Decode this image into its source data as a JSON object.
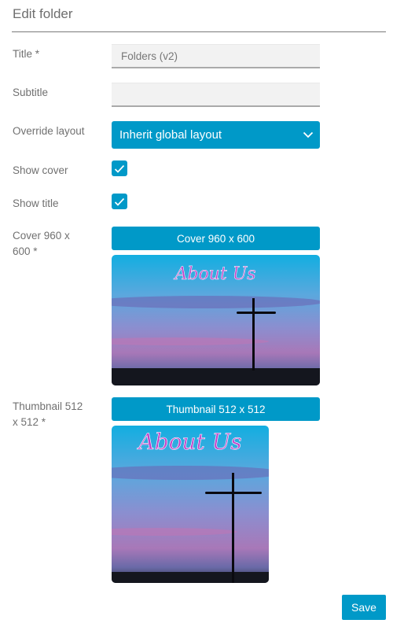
{
  "header": {
    "title": "Edit folder"
  },
  "form": {
    "title": {
      "label": "Title *",
      "value": "Folders (v2)",
      "placeholder": ""
    },
    "subtitle": {
      "label": "Subtitle",
      "value": "",
      "placeholder": ""
    },
    "override_layout": {
      "label": "Override layout",
      "selected": "Inherit global layout",
      "icon": "chevron-down-icon"
    },
    "show_cover": {
      "label": "Show cover",
      "checked": true,
      "icon": "check-icon"
    },
    "show_title": {
      "label": "Show title",
      "checked": true,
      "icon": "check-icon"
    },
    "cover": {
      "label_line1": "Cover 960 x",
      "label_line2": "600 *",
      "button_label": "Cover 960 x 600",
      "image_caption": "About Us"
    },
    "thumbnail": {
      "label_line1": "Thumbnail 512",
      "label_line2": "x 512 *",
      "button_label": "Thumbnail 512 x 512",
      "image_caption": "About Us"
    }
  },
  "actions": {
    "save_label": "Save"
  },
  "colors": {
    "accent": "#0099c8",
    "heading": "#6e6e6e",
    "label": "#707070",
    "input_bg": "#f2f2f2",
    "caption": "#c040c8"
  }
}
